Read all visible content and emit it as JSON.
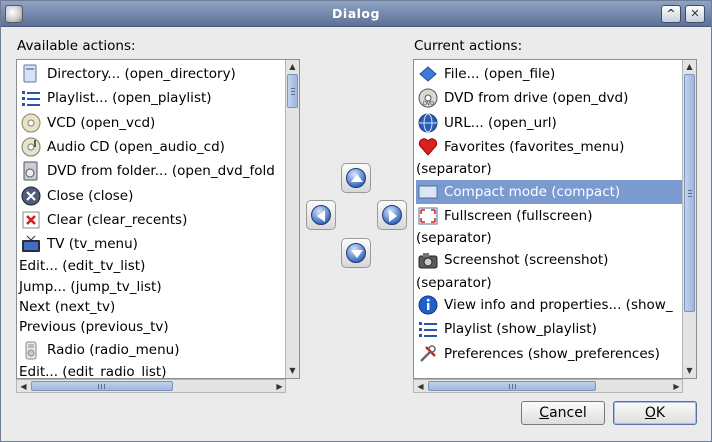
{
  "window": {
    "title": "Dialog",
    "help_btn": "^",
    "close_btn": "✕"
  },
  "available": {
    "label": "Available actions:",
    "items": [
      {
        "text": "Directory... (open_directory)",
        "icon": "folder-icon"
      },
      {
        "text": "Playlist... (open_playlist)",
        "icon": "list-icon"
      },
      {
        "text": "VCD (open_vcd)",
        "icon": "disc-icon"
      },
      {
        "text": "Audio CD (open_audio_cd)",
        "icon": "audio-cd-icon"
      },
      {
        "text": "DVD from folder... (open_dvd_fold",
        "icon": "dvd-folder-icon"
      },
      {
        "text": "Close (close)",
        "icon": "close-circle-icon"
      },
      {
        "text": "Clear (clear_recents)",
        "icon": "clear-icon"
      },
      {
        "text": "TV (tv_menu)",
        "icon": "tv-icon"
      },
      {
        "text": "Edit... (edit_tv_list)",
        "icon": ""
      },
      {
        "text": "Jump... (jump_tv_list)",
        "icon": ""
      },
      {
        "text": "Next (next_tv)",
        "icon": ""
      },
      {
        "text": "Previous (previous_tv)",
        "icon": ""
      },
      {
        "text": "Radio (radio_menu)",
        "icon": "radio-icon"
      },
      {
        "text": "Edit... (edit_radio_list)",
        "icon": ""
      }
    ]
  },
  "current": {
    "label": "Current actions:",
    "selected_index": 5,
    "items": [
      {
        "text": "File... (open_file)",
        "icon": "file-icon"
      },
      {
        "text": "DVD from drive (open_dvd)",
        "icon": "dvd-icon"
      },
      {
        "text": "URL... (open_url)",
        "icon": "globe-icon"
      },
      {
        "text": "Favorites (favorites_menu)",
        "icon": "heart-icon"
      },
      {
        "text": "(separator)",
        "icon": ""
      },
      {
        "text": "Compact mode (compact)",
        "icon": "compact-icon"
      },
      {
        "text": "Fullscreen (fullscreen)",
        "icon": "fullscreen-icon"
      },
      {
        "text": "(separator)",
        "icon": ""
      },
      {
        "text": "Screenshot (screenshot)",
        "icon": "camera-icon"
      },
      {
        "text": "(separator)",
        "icon": ""
      },
      {
        "text": "View info and properties... (show_",
        "icon": "info-icon"
      },
      {
        "text": "Playlist (show_playlist)",
        "icon": "list-icon"
      },
      {
        "text": "Preferences (show_preferences)",
        "icon": "tools-icon"
      }
    ]
  },
  "buttons": {
    "cancel": {
      "label_u": "C",
      "label_rest": "ancel"
    },
    "ok": {
      "label_u": "O",
      "label_rest": "K"
    }
  },
  "scroll_positions": {
    "available_v": 0.0,
    "current_v": 0.0,
    "available_h": 0.0,
    "current_h": 0.0
  },
  "colors": {
    "selection": "#7b9ad0",
    "titlebar": "#7086ad"
  }
}
